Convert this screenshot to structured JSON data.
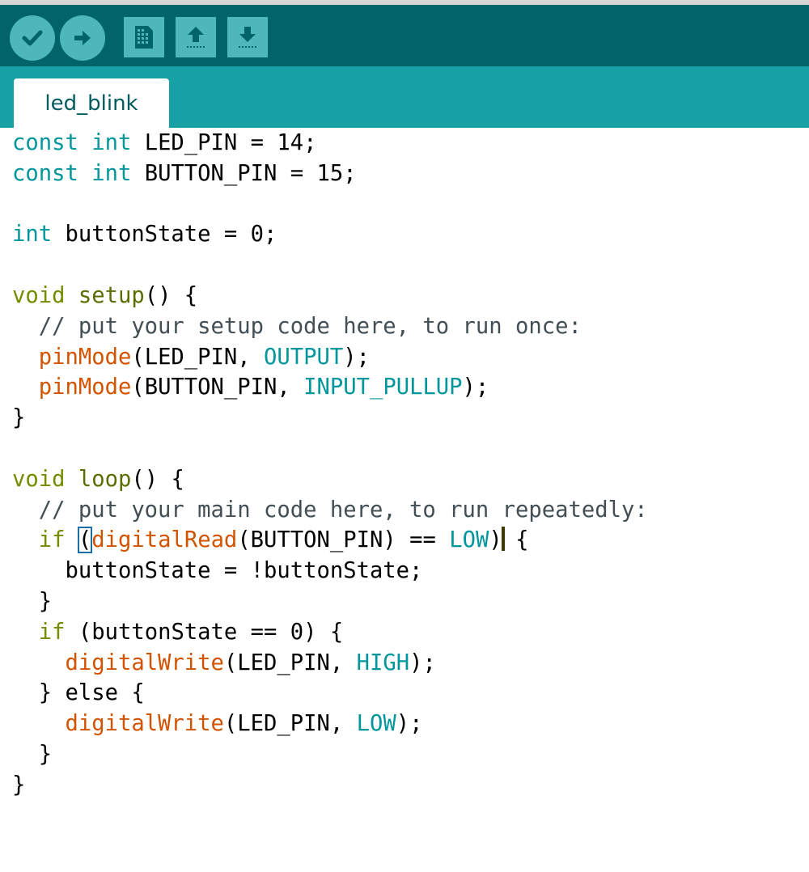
{
  "toolbar": {
    "buttons": [
      {
        "name": "verify",
        "icon": "check-icon"
      },
      {
        "name": "upload",
        "icon": "arrow-right-icon"
      },
      {
        "name": "new",
        "icon": "new-file-icon"
      },
      {
        "name": "open",
        "icon": "arrow-up-icon"
      },
      {
        "name": "save",
        "icon": "arrow-down-icon"
      }
    ]
  },
  "tabs": [
    {
      "label": "led_blink",
      "active": true
    }
  ],
  "colors": {
    "toolbar": "#006468",
    "tabbar": "#17a1a5",
    "button": "#4db7bb",
    "keyword": "#00979c",
    "control": "#728e00",
    "function_def": "#5e6d03",
    "function_call": "#d35400",
    "comment": "#434f54"
  },
  "editor": {
    "lines": [
      [
        [
          "kw",
          "const int"
        ],
        [
          "plain",
          " LED_PIN = 14;"
        ]
      ],
      [
        [
          "kw",
          "const int"
        ],
        [
          "plain",
          " BUTTON_PIN = 15;"
        ]
      ],
      [],
      [
        [
          "kw",
          "int"
        ],
        [
          "plain",
          " buttonState = 0;"
        ]
      ],
      [],
      [
        [
          "kw2",
          "void"
        ],
        [
          "plain",
          " "
        ],
        [
          "fn",
          "setup"
        ],
        [
          "plain",
          "() {"
        ]
      ],
      [
        [
          "cmt",
          "  // put your setup code here, to run once:"
        ]
      ],
      [
        [
          "plain",
          "  "
        ],
        [
          "call",
          "pinMode"
        ],
        [
          "plain",
          "(LED_PIN, "
        ],
        [
          "const",
          "OUTPUT"
        ],
        [
          "plain",
          ");"
        ]
      ],
      [
        [
          "plain",
          "  "
        ],
        [
          "call",
          "pinMode"
        ],
        [
          "plain",
          "(BUTTON_PIN, "
        ],
        [
          "const",
          "INPUT_PULLUP"
        ],
        [
          "plain",
          ");"
        ]
      ],
      [
        [
          "plain",
          "}"
        ]
      ],
      [],
      [
        [
          "kw2",
          "void"
        ],
        [
          "plain",
          " "
        ],
        [
          "fn",
          "loop"
        ],
        [
          "plain",
          "() {"
        ]
      ],
      [
        [
          "cmt",
          "  // put your main code here, to run repeatedly:"
        ]
      ],
      [
        [
          "plain",
          "  "
        ],
        [
          "kw2",
          "if"
        ],
        [
          "plain",
          " "
        ],
        [
          "match",
          "("
        ],
        [
          "call",
          "digitalRead"
        ],
        [
          "plain",
          "(BUTTON_PIN) == "
        ],
        [
          "const",
          "LOW"
        ],
        [
          "plain",
          ")"
        ],
        [
          "caret",
          ""
        ],
        [
          "plain",
          " {"
        ]
      ],
      [
        [
          "plain",
          "    buttonState = !buttonState;"
        ]
      ],
      [
        [
          "plain",
          "  }"
        ]
      ],
      [
        [
          "plain",
          "  "
        ],
        [
          "kw2",
          "if"
        ],
        [
          "plain",
          " (buttonState == 0) {"
        ]
      ],
      [
        [
          "plain",
          "    "
        ],
        [
          "call",
          "digitalWrite"
        ],
        [
          "plain",
          "(LED_PIN, "
        ],
        [
          "const",
          "HIGH"
        ],
        [
          "plain",
          ");"
        ]
      ],
      [
        [
          "plain",
          "  } else {"
        ]
      ],
      [
        [
          "plain",
          "    "
        ],
        [
          "call",
          "digitalWrite"
        ],
        [
          "plain",
          "(LED_PIN, "
        ],
        [
          "const",
          "LOW"
        ],
        [
          "plain",
          ");"
        ]
      ],
      [
        [
          "plain",
          "  }"
        ]
      ],
      [
        [
          "plain",
          "}"
        ]
      ]
    ]
  }
}
